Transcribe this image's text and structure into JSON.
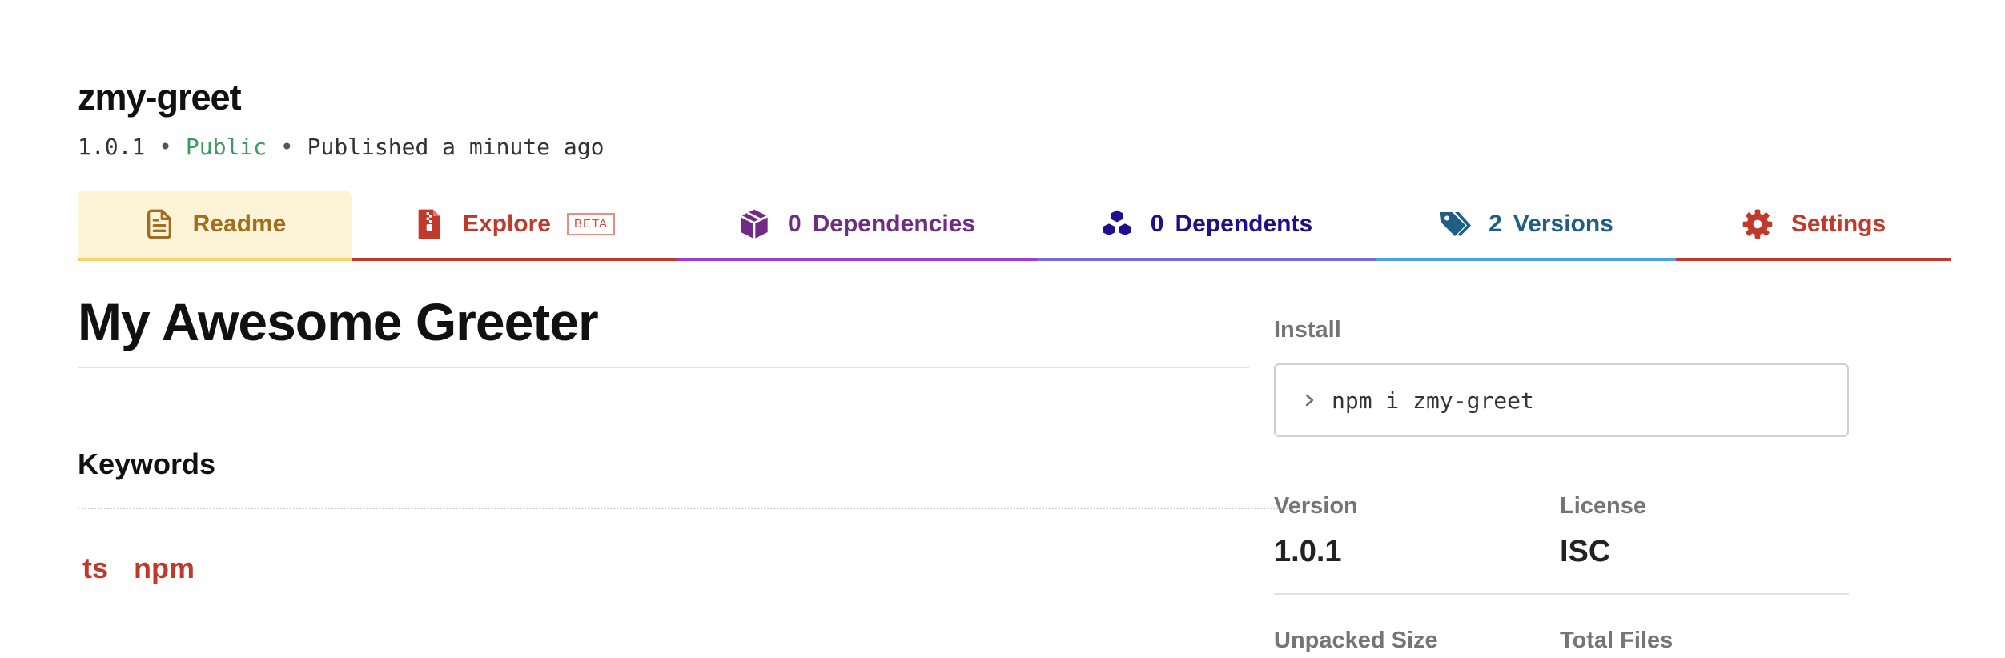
{
  "package": {
    "name": "zmy-greet",
    "version": "1.0.1",
    "bullet": "•",
    "visibility": "Public",
    "published": "Published a minute ago"
  },
  "tabs": {
    "readme": {
      "label": "Readme",
      "icon": "file-text-icon"
    },
    "explore": {
      "label": "Explore",
      "badge": "BETA",
      "icon": "zip-file-icon"
    },
    "dependencies": {
      "count": "0",
      "label": "Dependencies",
      "icon": "box-icon"
    },
    "dependents": {
      "count": "0",
      "label": "Dependents",
      "icon": "cubes-icon"
    },
    "versions": {
      "count": "2",
      "label": "Versions",
      "icon": "tags-icon"
    },
    "settings": {
      "label": "Settings",
      "icon": "gear-icon"
    }
  },
  "readme": {
    "title": "My Awesome Greeter",
    "keywords_heading": "Keywords",
    "keywords": [
      "ts",
      "npm"
    ]
  },
  "sidebar": {
    "install_label": "Install",
    "install_command": "npm i zmy-greet",
    "version_label": "Version",
    "version_value": "1.0.1",
    "license_label": "License",
    "license_value": "ISC",
    "unpacked_size_label": "Unpacked Size",
    "total_files_label": "Total Files"
  },
  "colors": {
    "readme_tab": "#a06e1e",
    "explore_tab": "#c0392b",
    "dependencies_tab": "#6f2b86",
    "dependents_tab": "#1e0f8c",
    "versions_tab": "#1f5f86",
    "settings_tab": "#c0392b",
    "public": "#3f9a62",
    "keyword": "#c0392b"
  }
}
